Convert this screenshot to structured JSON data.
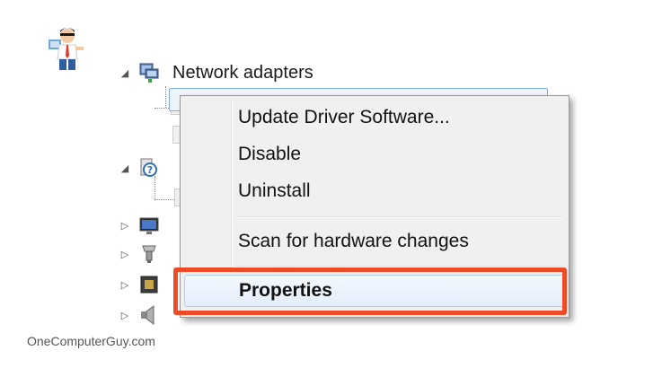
{
  "watermark": {
    "site": "OneComputerGuy.com",
    "logo_icon": "person-with-tie-logo"
  },
  "device_tree": {
    "network_adapters_label": "Network adapters",
    "expanded_glyph": "◢",
    "collapsed_glyph": "▷"
  },
  "context_menu": {
    "items": [
      {
        "label": "Update Driver Software..."
      },
      {
        "label": "Disable"
      },
      {
        "label": "Uninstall"
      },
      {
        "label": "Scan for hardware changes"
      },
      {
        "label": "Properties"
      }
    ],
    "highlighted_item": "Properties",
    "highlight_color": "#ef4b26"
  }
}
